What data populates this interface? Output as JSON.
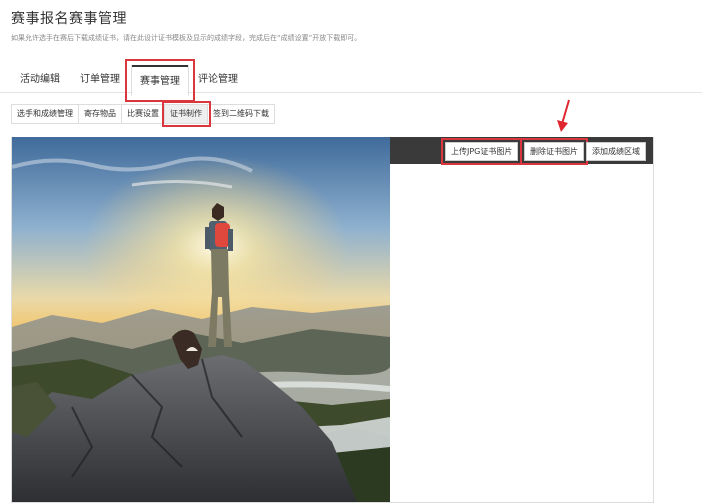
{
  "page": {
    "title": "赛事报名赛事管理",
    "description": "如果允许选手在赛后下载成绩证书，请在此设计证书模板及显示的成绩字段，完成后在“成绩设置”开放下载即可。"
  },
  "main_tabs": [
    {
      "label": "活动编辑"
    },
    {
      "label": "订单管理"
    },
    {
      "label": "赛事管理"
    },
    {
      "label": "评论管理"
    }
  ],
  "sub_tabs": [
    {
      "label": "选手和成绩管理"
    },
    {
      "label": "寄存物品"
    },
    {
      "label": "比赛设置"
    },
    {
      "label": "证书制作"
    },
    {
      "label": "签到二维码下载"
    }
  ],
  "toolbar": {
    "upload_label": "上传JPG证书图片",
    "delete_label": "删除证书图片",
    "add_region_label": "添加成绩区域"
  },
  "colors": {
    "highlight": "#d9363e",
    "toolbar_bg": "#3a3a3a"
  },
  "icons": {
    "annotation": "red-arrow-icon"
  }
}
